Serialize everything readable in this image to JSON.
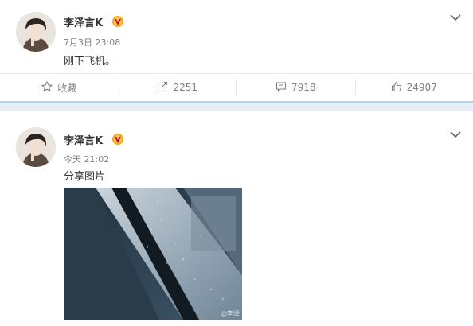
{
  "posts": [
    {
      "username": "李泽言K",
      "time": "7月3日 23:08",
      "text": "刚下飞机。",
      "actions": {
        "favorite_label": "收藏",
        "repost_count": "2251",
        "comment_count": "7918",
        "like_count": "24907"
      }
    },
    {
      "username": "李泽言K",
      "time": "今天 21:02",
      "text": "分享图片",
      "image": {
        "watermark": "@李泽"
      }
    }
  ],
  "icons": {
    "favorite": "star-icon",
    "repost": "repost-icon",
    "comment": "comment-icon",
    "like": "thumbs-up-icon",
    "menu": "chevron-down-icon",
    "vip": "vip-badge-icon"
  },
  "colors": {
    "divider_accent": "#a9d7f4",
    "vip_badge": "#f5a623",
    "meta_text": "#808080"
  }
}
